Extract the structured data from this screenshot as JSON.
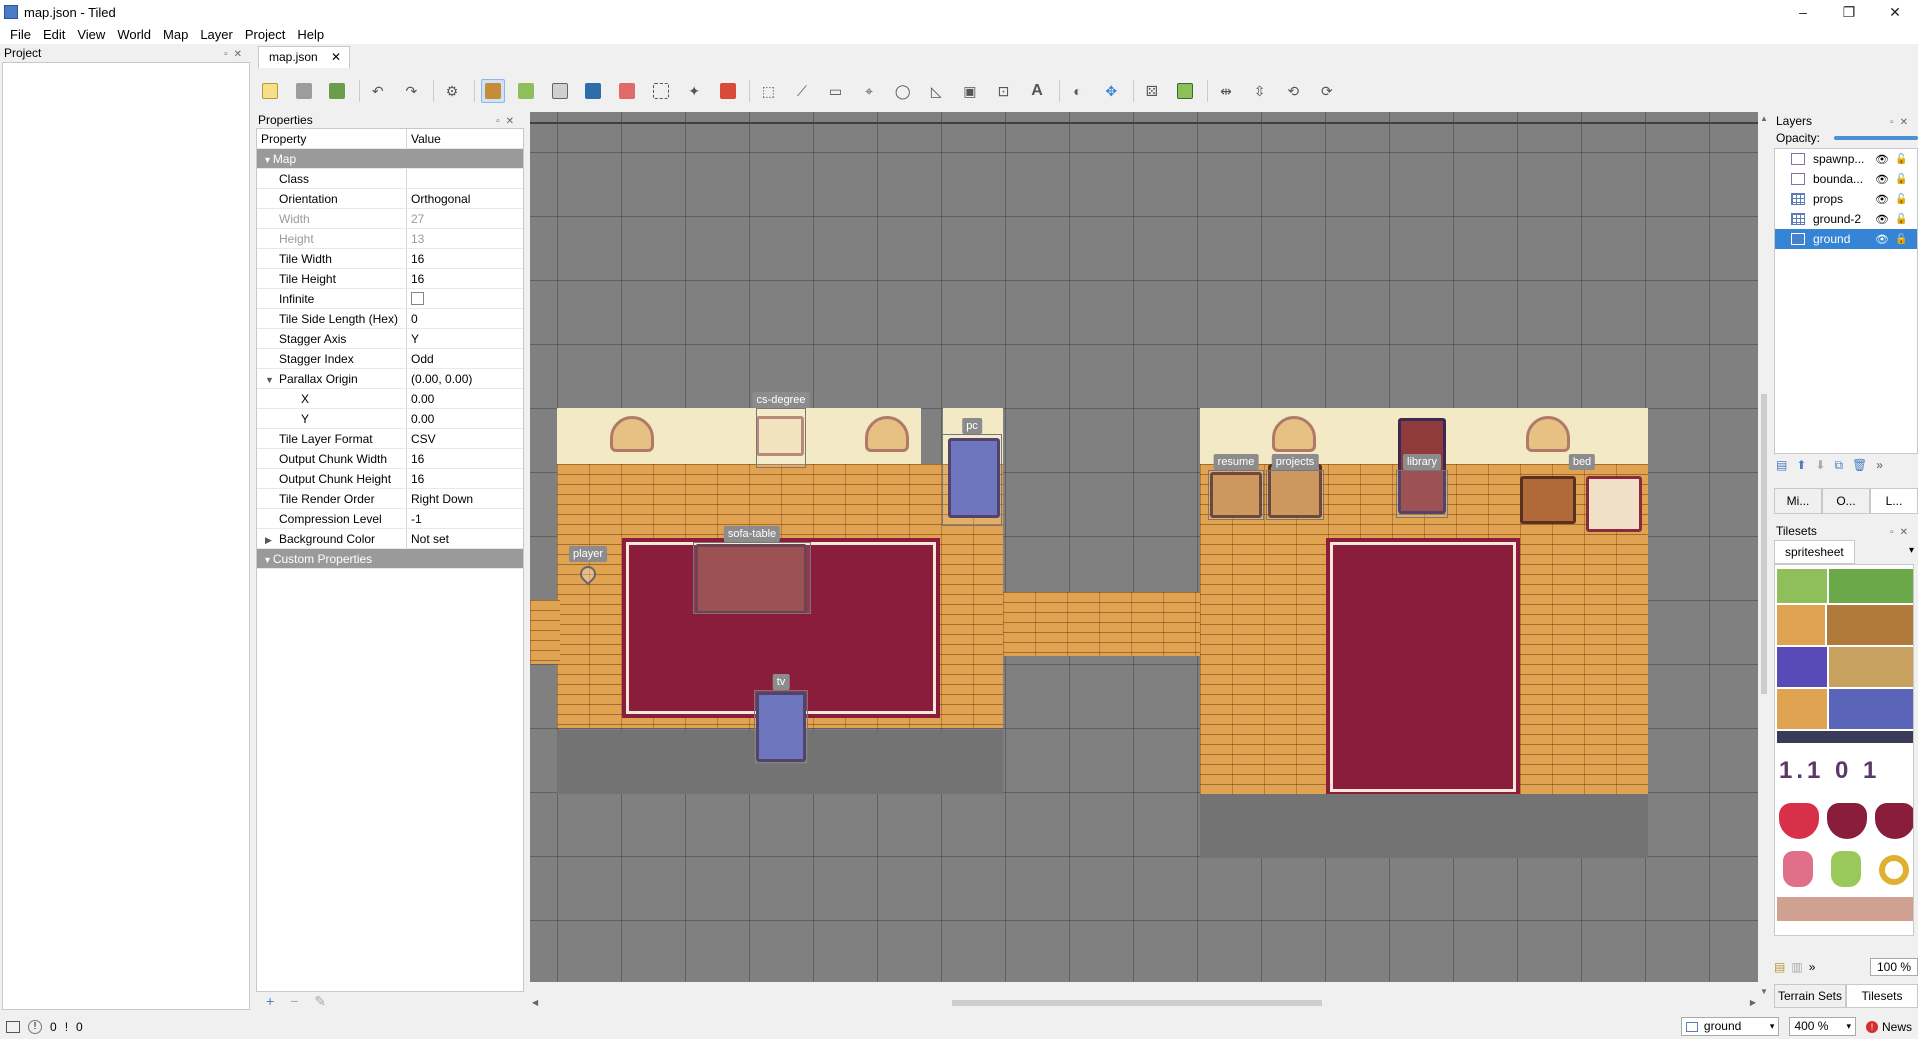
{
  "window": {
    "title": "map.json - Tiled",
    "min": "–",
    "max": "❐",
    "close": "✕"
  },
  "menu": [
    "File",
    "Edit",
    "View",
    "World",
    "Map",
    "Layer",
    "Project",
    "Help"
  ],
  "project_dock": {
    "title": "Project"
  },
  "document_tab": {
    "label": "map.json",
    "close": "✕"
  },
  "properties": {
    "title": "Properties",
    "col_property": "Property",
    "col_value": "Value",
    "rows": [
      {
        "name": "Map",
        "value": "",
        "kind": "group"
      },
      {
        "name": "Class",
        "value": ""
      },
      {
        "name": "Orientation",
        "value": "Orthogonal"
      },
      {
        "name": "Width",
        "value": "27",
        "kind": "disabled"
      },
      {
        "name": "Height",
        "value": "13",
        "kind": "disabled"
      },
      {
        "name": "Tile Width",
        "value": "16"
      },
      {
        "name": "Tile Height",
        "value": "16"
      },
      {
        "name": "Infinite",
        "value": "",
        "kind": "checkbox"
      },
      {
        "name": "Tile Side Length (Hex)",
        "value": "0"
      },
      {
        "name": "Stagger Axis",
        "value": "Y"
      },
      {
        "name": "Stagger Index",
        "value": "Odd"
      },
      {
        "name": "Parallax Origin",
        "value": "(0.00, 0.00)",
        "kind": "expanded"
      },
      {
        "name": "X",
        "value": "0.00",
        "kind": "sub"
      },
      {
        "name": "Y",
        "value": "0.00",
        "kind": "sub"
      },
      {
        "name": "Tile Layer Format",
        "value": "CSV"
      },
      {
        "name": "Output Chunk Width",
        "value": "16"
      },
      {
        "name": "Output Chunk Height",
        "value": "16"
      },
      {
        "name": "Tile Render Order",
        "value": "Right Down"
      },
      {
        "name": "Compression Level",
        "value": "-1"
      },
      {
        "name": "Background Color",
        "value": "Not set",
        "kind": "collapsed"
      },
      {
        "name": "Custom Properties",
        "value": "",
        "kind": "group"
      }
    ],
    "footer": {
      "add": "+",
      "remove": "−",
      "edit": "✎"
    }
  },
  "map_objects": {
    "cs_degree": "cs-degree",
    "pc": "pc",
    "sofa_table": "sofa-table",
    "player": "player",
    "tv": "tv",
    "resume": "resume",
    "projects": "projects",
    "library": "library",
    "bed": "bed"
  },
  "layers": {
    "title": "Layers",
    "opacity_label": "Opacity:",
    "items": [
      {
        "name": "spawnp...",
        "type": "object",
        "selected": false
      },
      {
        "name": "bounda...",
        "type": "object",
        "selected": false
      },
      {
        "name": "props",
        "type": "tile",
        "selected": false
      },
      {
        "name": "ground-2",
        "type": "tile",
        "selected": false
      },
      {
        "name": "ground",
        "type": "tile",
        "selected": true
      }
    ],
    "mini_tabs": [
      "Mi...",
      "O...",
      "L..."
    ]
  },
  "tilesets": {
    "title": "Tilesets",
    "tab": "spritesheet",
    "glyphs": "1.1 0 1",
    "zoom": "100 %",
    "bottom_tabs": [
      "Terrain Sets",
      "Tilesets"
    ]
  },
  "statusbar": {
    "errors": "0",
    "warnings": "0",
    "layer_combo": "ground",
    "zoom_combo": "400 %",
    "news": "News"
  },
  "colors": {
    "selection": "#3584d5",
    "floor": "#e0a352",
    "rug": "#8a1c3c",
    "wall": "#f3e9c4",
    "canvas_bg": "#808080"
  }
}
